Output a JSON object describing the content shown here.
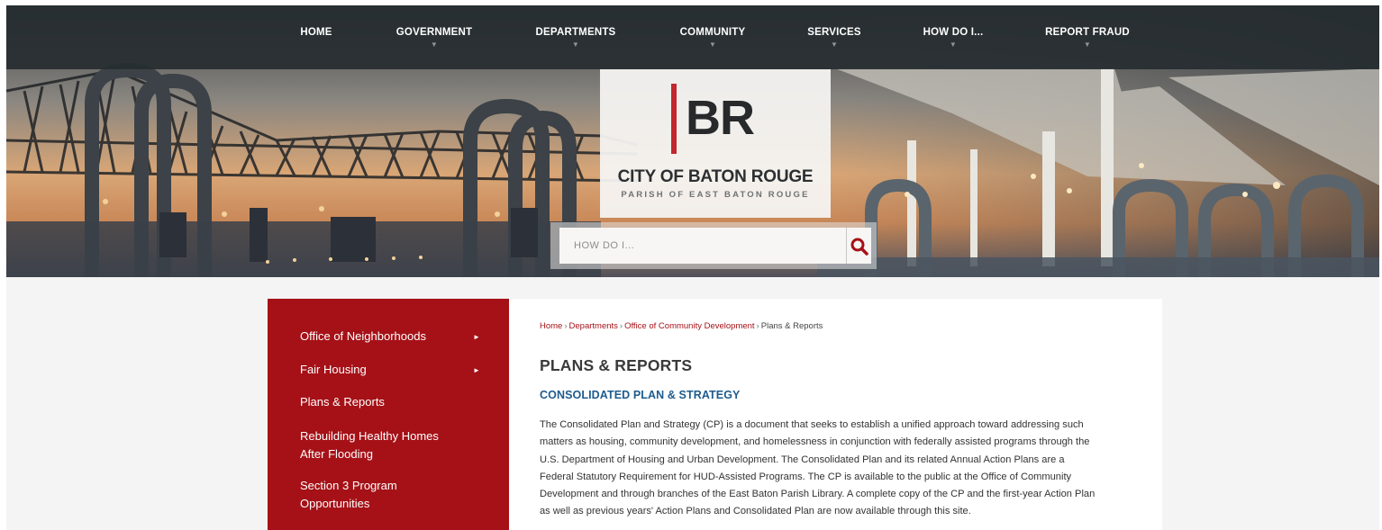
{
  "nav": {
    "items": [
      {
        "label": "HOME",
        "dropdown": false
      },
      {
        "label": "GOVERNMENT",
        "dropdown": true
      },
      {
        "label": "DEPARTMENTS",
        "dropdown": true
      },
      {
        "label": "COMMUNITY",
        "dropdown": true
      },
      {
        "label": "SERVICES",
        "dropdown": true
      },
      {
        "label": "HOW DO I...",
        "dropdown": true
      },
      {
        "label": "REPORT FRAUD",
        "dropdown": true
      }
    ],
    "caret": "▼"
  },
  "logo": {
    "mark": "BR",
    "city": "CITY OF BATON ROUGE",
    "parish": "PARISH OF EAST BATON ROUGE",
    "accent_color": "#c2272d"
  },
  "search": {
    "placeholder": "HOW DO I...",
    "icon": "search-icon"
  },
  "sidebar": {
    "background": "#a51117",
    "items": [
      {
        "label": "Office of Neighborhoods",
        "has_submenu": true
      },
      {
        "label": "Fair Housing",
        "has_submenu": true
      },
      {
        "label": "Plans & Reports",
        "has_submenu": false
      },
      {
        "label": "Rebuilding Healthy Homes After Flooding",
        "line1": "Rebuilding Healthy Homes",
        "line2": "After Flooding",
        "has_submenu": false
      },
      {
        "label": "Section 3 Program Opportunities",
        "line1": "Section 3 Program",
        "line2": "Opportunities",
        "has_submenu": false
      }
    ],
    "arrow": "►"
  },
  "breadcrumb": {
    "items": [
      "Home",
      "Departments",
      "Office of Community Development"
    ],
    "current": "Plans & Reports",
    "separator": "›"
  },
  "main": {
    "title": "PLANS & REPORTS",
    "section_title": "CONSOLIDATED PLAN & STRATEGY",
    "section_color": "#1e5b8e",
    "body_lines": [
      "The Consolidated Plan and Strategy (CP) is a document that seeks to establish a unified approach toward addressing such",
      "matters as housing, community development, and homelessness in conjunction with federally assisted programs through the",
      "U.S. Department of Housing and Urban Development. The Consolidated Plan and its related Annual Action Plans are a",
      "Federal Statutory Requirement for HUD-Assisted Programs. The CP is available to the public at the Office of Community",
      "Development and through branches of the East Baton Parish Library. A complete copy of the CP and the first-year Action Plan",
      "as well as previous years' Action Plans and Consolidated Plan are now available through this site."
    ]
  }
}
